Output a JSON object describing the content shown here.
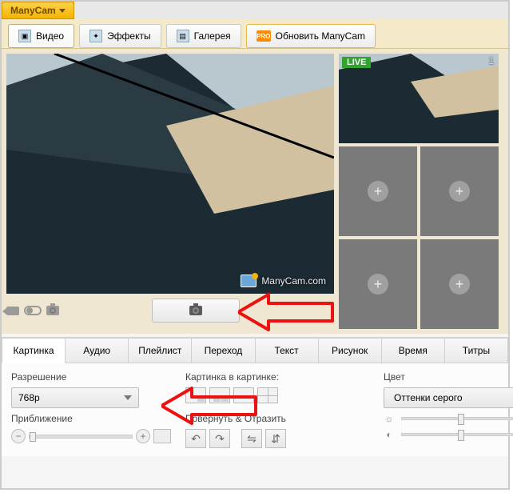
{
  "brand": {
    "name": "ManyCam"
  },
  "tabs": {
    "video": "Видео",
    "effects": "Эффекты",
    "gallery": "Галерея",
    "upgrade": "Обновить ManyCam",
    "pro_badge": "PRO"
  },
  "preview": {
    "watermark": "ManyCam.com",
    "live_badge": "LIVE",
    "thumb1_num": "1"
  },
  "bottom_tabs": {
    "picture": "Картинка",
    "audio": "Аудио",
    "playlist": "Плейлист",
    "transition": "Переход",
    "text": "Текст",
    "drawing": "Рисунок",
    "time": "Время",
    "titles": "Титры"
  },
  "panel": {
    "resolution_label": "Разрешение",
    "resolution_value": "768p",
    "pip_label": "Картинка в картинке:",
    "color_label": "Цвет",
    "grayscale_btn": "Оттенки серого",
    "zoom_label": "Приближение",
    "rotate_label": "Повернуть & Отразить",
    "brightness_icon": "☼",
    "contrast_icon": "◐"
  }
}
